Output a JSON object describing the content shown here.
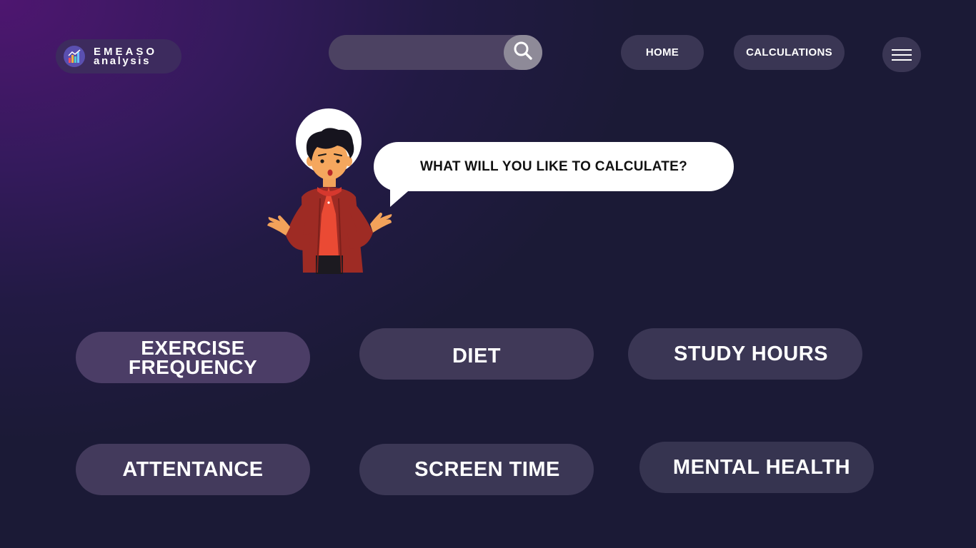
{
  "colors": {
    "bg_purple": "#4e1670",
    "bg_navy": "#1b1a36",
    "pill": "#3a3654",
    "pill_light": "#4b3d66",
    "search_button": "#8e8a98",
    "bubble": "#ffffff"
  },
  "header": {
    "logo": {
      "line1": "EMEASO",
      "line2": "analysis",
      "icon": "bar-chart-icon"
    },
    "search": {
      "placeholder": "",
      "value": "",
      "icon": "search-icon"
    },
    "nav": {
      "home": "HOME",
      "calculations": "CALCULATIONS"
    },
    "menu": {
      "icon": "hamburger-menu-icon"
    }
  },
  "hero": {
    "prompt": "WHAT WILL YOU LIKE TO CALCULATE?",
    "illustration": "confused-person-shrugging"
  },
  "categories": {
    "exercise": {
      "line1": "EXERCISE",
      "line2": "FREQUENCY"
    },
    "diet": "DIET",
    "study_hours": "STUDY HOURS",
    "attendance": "ATTENTANCE",
    "screen_time": "SCREEN TIME",
    "mental_health": "MENTAL HEALTH"
  }
}
